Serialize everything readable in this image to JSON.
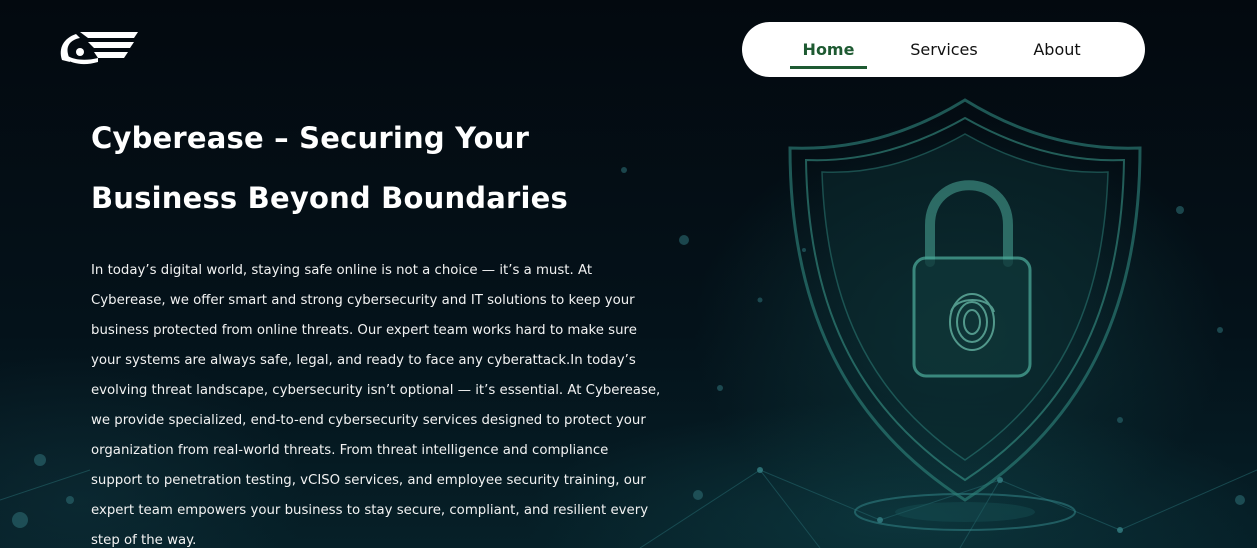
{
  "brand": {
    "logo_icon": "cyberease-logo-icon"
  },
  "nav": {
    "items": [
      {
        "label": "Home",
        "active": true
      },
      {
        "label": "Services",
        "active": false
      },
      {
        "label": "About",
        "active": false
      }
    ],
    "active_color": "#1e5a32"
  },
  "hero": {
    "title_line1": "Cyberease – Securing Your",
    "title_line2": "Business Beyond Boundaries",
    "paragraph": "In today’s digital world, staying safe online is not a choice — it’s a must. At Cyberease, we offer smart and strong cybersecurity and IT solutions to keep your business protected from online threats. Our expert team works hard to make sure your systems are always safe, legal, and ready to face any cyberattack.In today’s evolving threat landscape, cybersecurity isn’t optional — it’s essential. At Cyberease, we provide specialized, end-to-end cybersecurity services designed to protect your organization from real-world threats. From threat intelligence and compliance support to penetration testing, vCISO services, and employee security training, our expert team empowers your business to stay secure, compliant, and resilient every step of the way.",
    "background_icon": "shield-lock-fingerprint-icon"
  },
  "colors": {
    "background": "#020a10",
    "glow": "#2a8a8a",
    "text": "#ffffff"
  }
}
